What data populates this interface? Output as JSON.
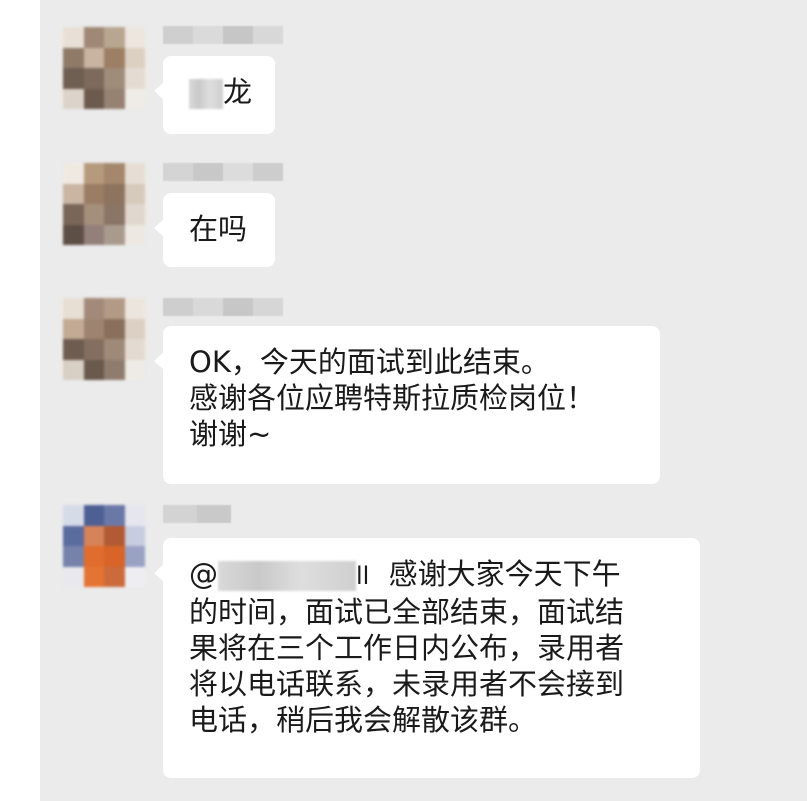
{
  "messages": [
    {
      "text_visible": "龙"
    },
    {
      "text": "在吗"
    },
    {
      "lines": [
        "OK，今天的面试到此结束。",
        "感谢各位应聘特斯拉质检岗位！",
        "谢谢~"
      ]
    },
    {
      "mention_prefix": "@",
      "mention_suffix": "ll",
      "first_line_rest": "感谢大家今天下午",
      "lines": [
        "的时间，面试已全部结束，面试结",
        "果将在三个工作日内公布，录用者",
        "将以电话联系，未录用者不会接到",
        "电话，稍后我会解散该群。"
      ]
    }
  ],
  "colors": {
    "background": "#ebebeb",
    "bubble": "#ffffff",
    "text": "#1a1a1a"
  }
}
